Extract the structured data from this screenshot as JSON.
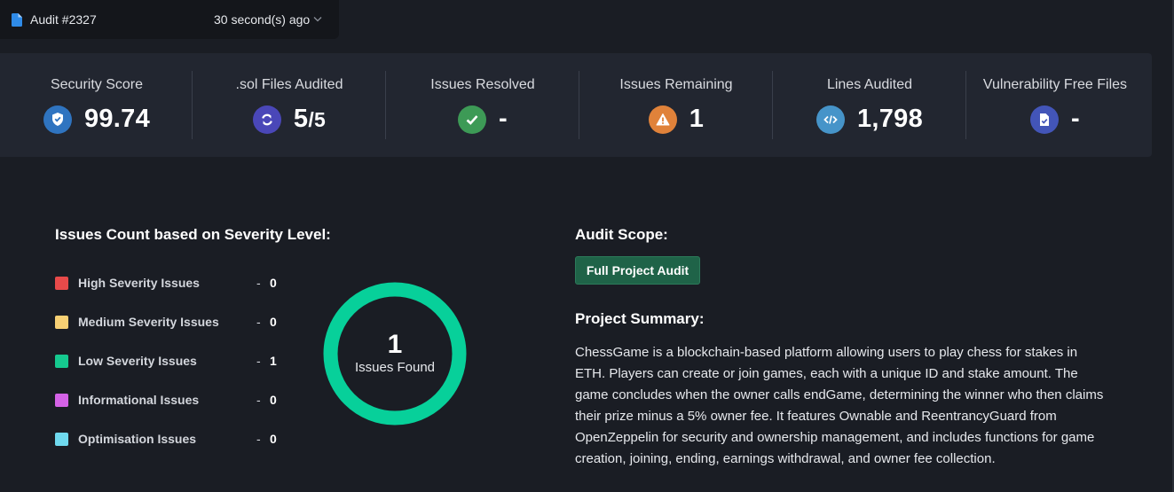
{
  "audit": {
    "name": "Audit #2327",
    "time": "30 second(s) ago",
    "icons": {
      "file": "file-icon",
      "dropdown": "chevron-down-icon"
    }
  },
  "stats": [
    {
      "label": "Security Score",
      "value": "99.74",
      "icon": "shield-icon",
      "color": "#2f74c0"
    },
    {
      "label": ".sol Files Audited",
      "value": "5",
      "value_suffix": "/5",
      "icon": "sync-icon",
      "color": "#4a47b8"
    },
    {
      "label": "Issues Resolved",
      "value": "-",
      "icon": "check-icon",
      "color": "#3d9a56"
    },
    {
      "label": "Issues Remaining",
      "value": "1",
      "icon": "warning-icon",
      "color": "#e0823a"
    },
    {
      "label": "Lines Audited",
      "value": "1,798",
      "icon": "code-icon",
      "color": "#4694c9"
    },
    {
      "label": "Vulnerability Free Files",
      "value": "-",
      "icon": "file-check-icon",
      "color": "#4355b8"
    }
  ],
  "severity": {
    "title": "Issues Count based on Severity Level:",
    "items": [
      {
        "label": "High Severity Issues",
        "dash": "-",
        "count": "0",
        "color": "#e84a4a"
      },
      {
        "label": "Medium Severity Issues",
        "dash": "-",
        "count": "0",
        "color": "#f7d074"
      },
      {
        "label": "Low Severity Issues",
        "dash": "-",
        "count": "1",
        "color": "#15c98f"
      },
      {
        "label": "Informational Issues",
        "dash": "-",
        "count": "0",
        "color": "#d462e6"
      },
      {
        "label": "Optimisation Issues",
        "dash": "-",
        "count": "0",
        "color": "#6fd9ee"
      }
    ],
    "total": "1",
    "total_label": "Issues Found",
    "ring_color": "#07d09a"
  },
  "scope": {
    "title": "Audit Scope:",
    "button": "Full Project Audit"
  },
  "summary": {
    "title": "Project Summary:",
    "text": "ChessGame is a blockchain-based platform allowing users to play chess for stakes in ETH. Players can create or join games, each with a unique ID and stake amount. The game concludes when the owner calls endGame, determining the winner who then claims their prize minus a 5% owner fee. It features Ownable and ReentrancyGuard from OpenZeppelin for security and ownership management, and includes functions for game creation, joining, ending, earnings withdrawal, and owner fee collection."
  }
}
